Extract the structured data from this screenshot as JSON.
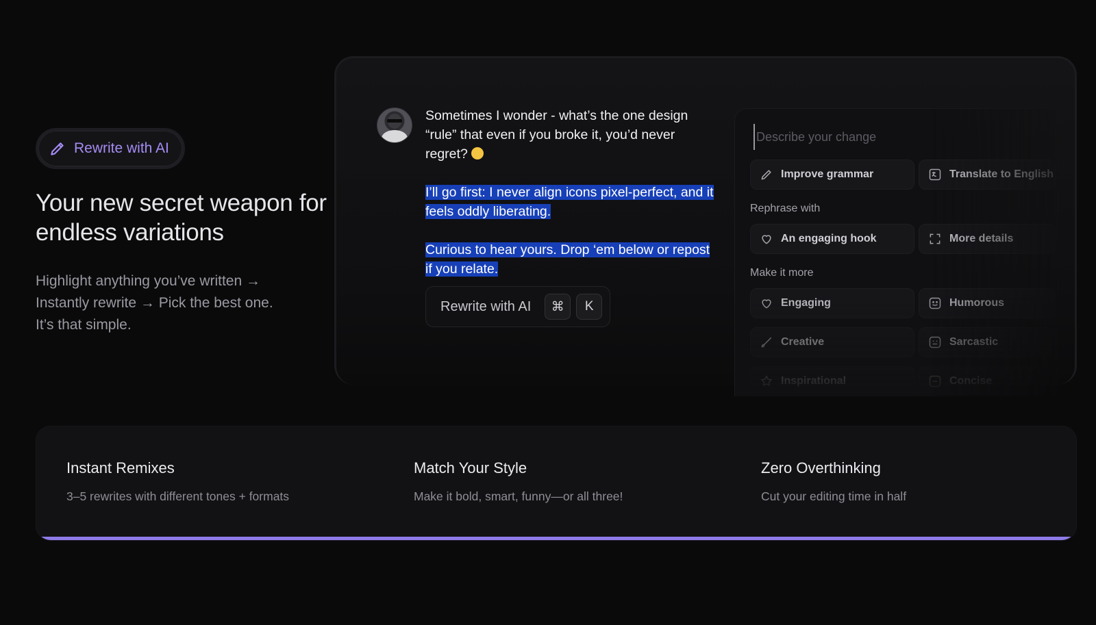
{
  "hero": {
    "badge_label": "Rewrite with AI",
    "title_line1": "Your new secret weapon for",
    "title_line2": "endless variations",
    "desc_line1": "Highlight anything you’ve written →",
    "desc_line2": "Instantly rewrite → Pick the best one.",
    "desc_line3": "It’s that simple."
  },
  "post": {
    "para1": "Sometimes I wonder - what’s the one design “rule” that even if you broke it, you’d never regret?",
    "para2": "I’ll go first: I never align icons pixel-perfect, and it feels oddly liberating.",
    "para3": "Curious to hear yours. Drop ‘em below or repost if you relate.",
    "selection_color": "#1740b8"
  },
  "rewrite_bar": {
    "label": "Rewrite with AI",
    "key1": "⌘",
    "key2": "K"
  },
  "panel": {
    "input_placeholder": "Describe your change",
    "quick_actions": [
      {
        "label": "Improve grammar",
        "icon": "pencil-icon"
      },
      {
        "label": "Translate to English",
        "icon": "translate-icon"
      }
    ],
    "rephrase_label": "Rephrase with",
    "rephrase": [
      {
        "label": "An engaging hook",
        "icon": "heart-icon"
      },
      {
        "label": "More details",
        "icon": "expand-icon"
      }
    ],
    "make_more_label": "Make it more",
    "make_more": [
      {
        "label": "Engaging",
        "icon": "heart-icon"
      },
      {
        "label": "Humorous",
        "icon": "smile-icon"
      },
      {
        "label": "Creative",
        "icon": "brush-icon"
      },
      {
        "label": "Sarcastic",
        "icon": "smirk-icon"
      },
      {
        "label": "Inspirational",
        "icon": "star-icon"
      },
      {
        "label": "Concise",
        "icon": "compress-icon"
      }
    ]
  },
  "features": [
    {
      "title": "Instant Remixes",
      "desc": "3–5 rewrites with different tones + formats"
    },
    {
      "title": "Match Your Style",
      "desc": "Make it bold, smart, funny—or all three!"
    },
    {
      "title": "Zero Overthinking",
      "desc": "Cut your editing time in half"
    }
  ],
  "colors": {
    "accent": "#a58cf4",
    "accent_bar": "#8f7ae9",
    "background": "#0a0a0b"
  }
}
